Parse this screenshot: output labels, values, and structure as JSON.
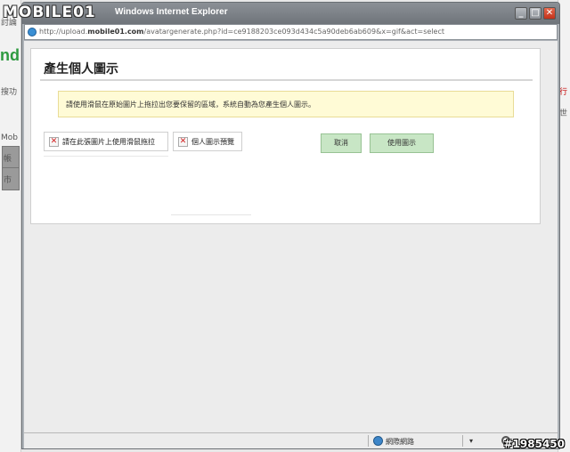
{
  "window": {
    "title": "Windows Internet Explorer",
    "logo": "MOBILE01",
    "min_glyph": "_",
    "max_glyph": "□",
    "close_glyph": "✕"
  },
  "address": {
    "url_prefix": "http://upload.",
    "url_host": "mobile01.com",
    "url_rest": "/avatargenerate.php?id=ce9188203ce093d434c5a90deb6ab609&x=gif&act=select"
  },
  "panel": {
    "title": "產生個人圖示",
    "notice": "請使用滑鼠在原始圖片上拖拉出您要保留的區域，系統自動為您產生個人圖示。",
    "source_image_label": "請在此張圖片上使用滑鼠拖拉",
    "preview_image_label": "個人圖示預覽",
    "cancel_label": "取消",
    "use_label": "使用圖示"
  },
  "statusbar": {
    "zone_label": "網際網路",
    "zoom_dropdown": "▾"
  },
  "background_page": {
    "left_fragment_1": "nd",
    "left_fragment_2": "搜功",
    "left_fragment_3": "Mob",
    "left_fragment_4": "帳",
    "left_fragment_5": "市",
    "left_fragment_6": "討論",
    "right_fragment_1": "行",
    "right_fragment_2": "世"
  },
  "watermark": "#1985450",
  "colors": {
    "button_green": "#c8e6c5",
    "notice_yellow": "#fffbd6",
    "close_red": "#c4311a"
  }
}
